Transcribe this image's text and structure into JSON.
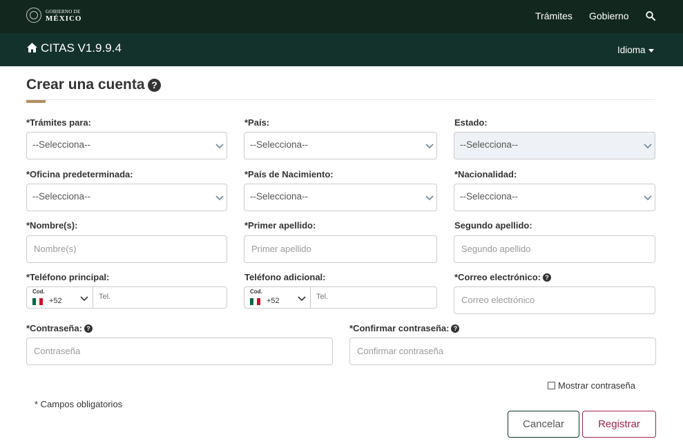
{
  "header": {
    "logo_line1": "GOBIERNO DE",
    "logo_line2": "MÉXICO",
    "nav": [
      "Trámites",
      "Gobierno"
    ],
    "search_icon": "search-icon"
  },
  "subheader": {
    "home_icon": "home-icon",
    "app_title": "CITAS V1.9.9.4",
    "language_label": "Idioma"
  },
  "form": {
    "title": "Crear una cuenta",
    "help_glyph": "?",
    "tramites_para": {
      "label": "*Trámites para:",
      "value": "--Selecciona--"
    },
    "pais": {
      "label": "*País:",
      "value": "--Selecciona--"
    },
    "estado": {
      "label": "Estado:",
      "value": "--Selecciona--"
    },
    "oficina": {
      "label": "*Oficina predeterminada:",
      "value": "--Selecciona--"
    },
    "pais_nacimiento": {
      "label": "*País de Nacimiento:",
      "value": "--Selecciona--"
    },
    "nacionalidad": {
      "label": "*Nacionalidad:",
      "value": "--Selecciona--"
    },
    "nombre": {
      "label": "*Nombre(s):",
      "placeholder": "Nombre(s)"
    },
    "primer_apellido": {
      "label": "*Primer apellido:",
      "placeholder": "Primer apellido"
    },
    "segundo_apellido": {
      "label": "Segundo apellido:",
      "placeholder": "Segundo apellido"
    },
    "telefono_principal": {
      "label": "*Teléfono principal:",
      "code_label": "Cod.",
      "dial_code": "+52",
      "placeholder": "Tel."
    },
    "telefono_adicional": {
      "label": "Teléfono adicional:",
      "code_label": "Cod.",
      "dial_code": "+52",
      "placeholder": "Tel."
    },
    "correo": {
      "label": "*Correo electrónico:",
      "placeholder": "Correo electrónico"
    },
    "contrasena": {
      "label": "*Contraseña:",
      "placeholder": "Contraseña"
    },
    "confirmar": {
      "label": "*Confirmar contraseña:",
      "placeholder": "Confirmar contraseña"
    },
    "mostrar_contrasena": "Mostrar contraseña",
    "required_note": "* Campos obligatorios",
    "cancel_label": "Cancelar",
    "register_label": "Registrar"
  },
  "colors": {
    "header_bg": "#12281e",
    "subheader_bg": "#13322b",
    "accent_gold": "#b38e5d",
    "register_maroon": "#9d2449",
    "flag_green": "#006847",
    "flag_red": "#ce1126"
  }
}
